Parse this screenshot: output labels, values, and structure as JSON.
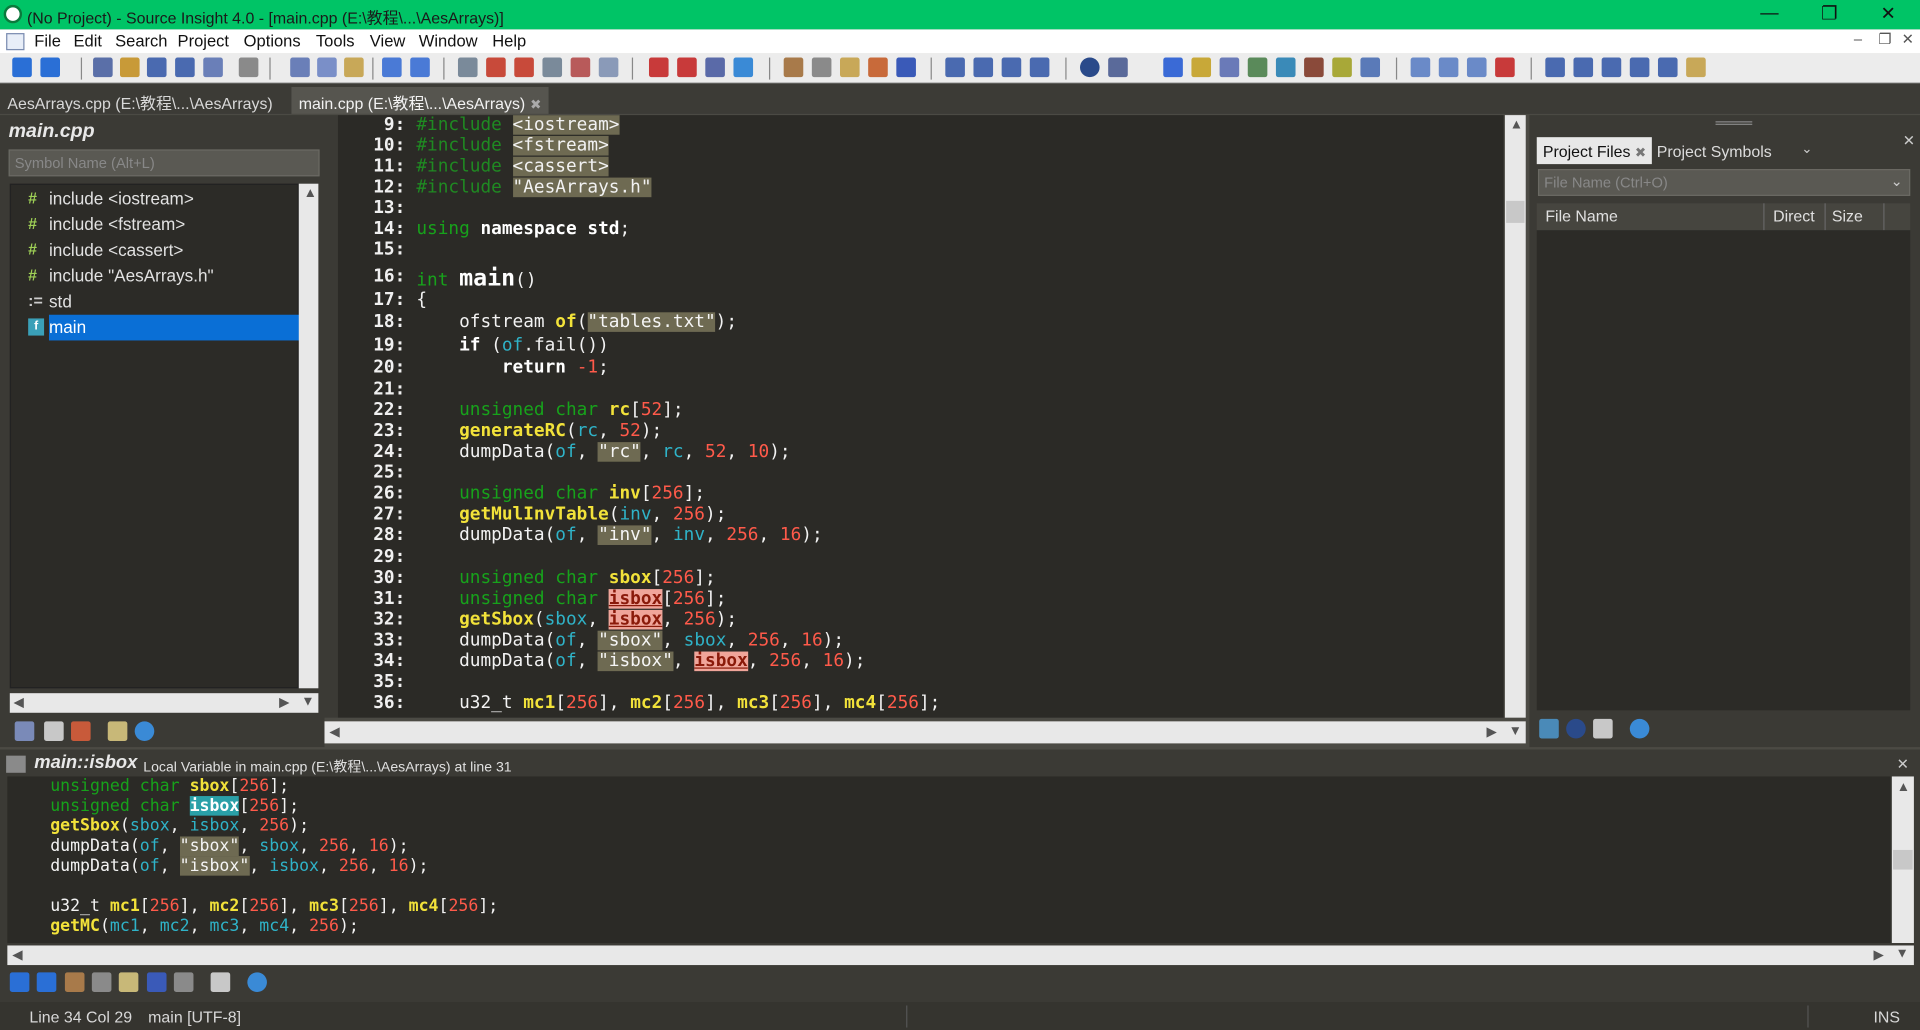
{
  "window": {
    "title": "(No Project) - Source Insight 4.0 - [main.cpp (E:\\教程\\...\\AesArrays)]"
  },
  "menu": [
    "File",
    "Edit",
    "Search",
    "Project",
    "Options",
    "Tools",
    "View",
    "Window",
    "Help"
  ],
  "tabs": [
    {
      "label": "AesArrays.cpp (E:\\教程\\...\\AesArrays)",
      "active": false
    },
    {
      "label": "main.cpp (E:\\教程\\...\\AesArrays)",
      "active": true,
      "close": "✖"
    }
  ],
  "symbol_window": {
    "file_name": "main.cpp",
    "search_placeholder": "Symbol Name (Alt+L)",
    "items": [
      {
        "icon": "#",
        "label": "include <iostream>"
      },
      {
        "icon": "#",
        "label": "include <fstream>"
      },
      {
        "icon": "#",
        "label": "include <cassert>"
      },
      {
        "icon": "#",
        "label": "include \"AesArrays.h\""
      },
      {
        "icon": ":=",
        "label": "std"
      },
      {
        "icon": "f",
        "label": "main",
        "selected": true
      }
    ]
  },
  "editor": {
    "line_numbers": [
      "9:",
      "10:",
      "11:",
      "12:",
      "13:",
      "14:",
      "15:",
      "16:",
      "17:",
      "18:",
      "19:",
      "20:",
      "21:",
      "22:",
      "23:",
      "24:",
      "25:",
      "26:",
      "27:",
      "28:",
      "29:",
      "30:",
      "31:",
      "32:",
      "33:",
      "34:",
      "35:",
      "36:"
    ]
  },
  "project_window": {
    "tabs": [
      "Project Files",
      "Project Symbols"
    ],
    "tab_close": "✖",
    "file_placeholder": "File Name (Ctrl+O)",
    "columns": [
      "File Name",
      "Direct",
      "Size"
    ]
  },
  "context_window": {
    "symbol": "main::isbox",
    "description": "Local Variable in main.cpp (E:\\教程\\...\\AesArrays) at line 31"
  },
  "status": {
    "position": "Line 34  Col 29",
    "scope": "main [UTF-8]",
    "mode": "INS"
  },
  "colors": {
    "titlebar": "#00c466",
    "editor_bg": "#2b2a26",
    "selection": "#0a6fd6",
    "keyword": "#17a21b",
    "function": "#f2e23a",
    "number": "#ff5a4a"
  }
}
